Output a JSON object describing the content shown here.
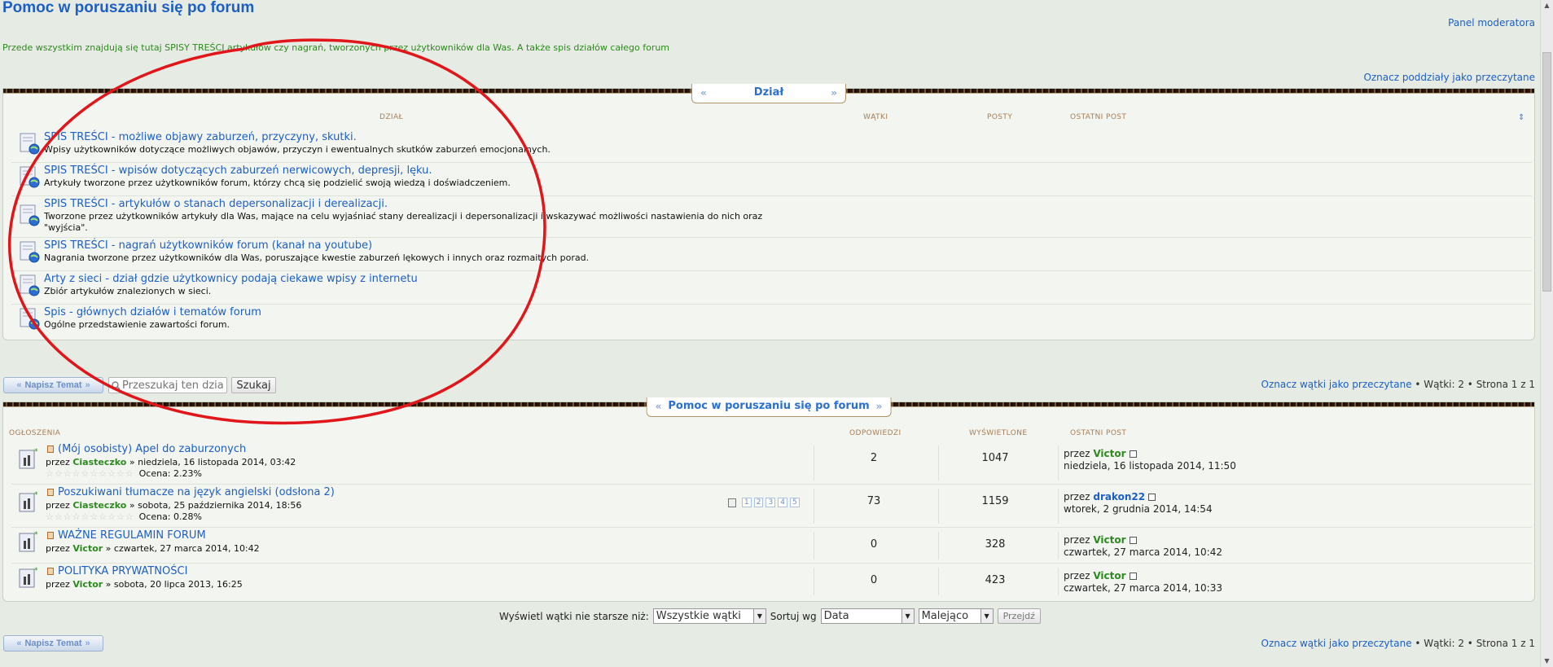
{
  "header": {
    "title": "Pomoc w poruszaniu się po forum",
    "moderator_panel": "Panel moderatora",
    "intro": "Przede wszystkim znajdują się tutaj SPISY TREŚCI artykułów czy nagrań, tworzonych przez użytkowników dla Was. A także spis działów całego forum",
    "mark_subforums_read": "Oznacz poddziały jako przeczytane"
  },
  "subforums": {
    "tab_label": "Dział",
    "columns": {
      "forum": "DZIAŁ",
      "threads": "WĄTKI",
      "posts": "POSTY",
      "last_post": "OSTATNI POST"
    },
    "rows": [
      {
        "title": "SPIS TREŚCI - możliwe objawy zaburzeń, przyczyny, skutki.",
        "desc": "Wpisy użytkowników dotyczące możliwych objawów, przyczyn i ewentualnych skutków zaburzeń emocjonalnych."
      },
      {
        "title": "SPIS TREŚCI - wpisów dotyczących zaburzeń nerwicowych, depresji, lęku.",
        "desc": "Artykuły tworzone przez użytkowników forum, którzy chcą się podzielić swoją wiedzą i doświadczeniem."
      },
      {
        "title": "SPIS TREŚCI - artykułów o stanach depersonalizacji i derealizacji.",
        "desc": "Tworzone przez użytkowników artykuły dla Was, mające na celu wyjaśniać stany derealizacji i depersonalizacji i wskazywać możliwości nastawienia do nich oraz \"wyjścia\"."
      },
      {
        "title": "SPIS TREŚCI - nagrań użytkowników forum (kanał na youtube)",
        "desc": "Nagrania tworzone przez użytkowników dla Was, poruszające kwestie zaburzeń lękowych i innych oraz rozmaitych porad."
      },
      {
        "title": "Arty z sieci - dział gdzie użytkownicy podają ciekawe wpisy z internetu",
        "desc": "Zbiór artykułów znalezionych w sieci."
      },
      {
        "title": "Spis - głównych działów i tematów forum",
        "desc": "Ogólne przedstawienie zawartości forum."
      }
    ]
  },
  "toolbar": {
    "new_topic": "Napisz Temat",
    "search_placeholder": "Przeszukaj ten dział",
    "search_button": "Szukaj",
    "mark_topics_read": "Oznacz wątki jako przeczytane",
    "stats": " • Wątki: 2 • Strona 1 z 1"
  },
  "topics": {
    "tab_label": "Pomoc w poruszaniu się po forum",
    "columns": {
      "announcements": "OGŁOSZENIA",
      "replies": "ODPOWIEDZI",
      "views": "WYŚWIETLONE",
      "last_post": "OSTATNI POST"
    },
    "rows": [
      {
        "title": "(Mój osobisty) Apel do zaburzonych",
        "by": "przez",
        "author": "Ciasteczko",
        "date": " » niedziela, 16 listopada 2014, 03:42",
        "rating": "Ocena: 2.23%",
        "replies": "2",
        "views": "1047",
        "lp_by": "przez",
        "lp_author": "Victor",
        "lp_date": "niedziela, 16 listopada 2014, 11:50"
      },
      {
        "title": "Poszukiwani tłumacze na język angielski (odsłona 2)",
        "by": "przez",
        "author": "Ciasteczko",
        "date": " » sobota, 25 października 2014, 18:56",
        "rating": "Ocena: 0.28%",
        "replies": "73",
        "views": "1159",
        "lp_by": "przez",
        "lp_author": "drakon22",
        "lp_date": "wtorek, 2 grudnia 2014, 14:54",
        "pages": [
          "1",
          "2",
          "3",
          "4",
          "5"
        ]
      },
      {
        "title": "WAŻNE REGULAMIN FORUM",
        "by": "przez",
        "author": "Victor",
        "date": " » czwartek, 27 marca 2014, 10:42",
        "replies": "0",
        "views": "328",
        "lp_by": "przez",
        "lp_author": "Victor",
        "lp_date": "czwartek, 27 marca 2014, 10:42"
      },
      {
        "title": "POLITYKA PRYWATNOŚCI",
        "by": "przez",
        "author": "Victor",
        "date": " » sobota, 20 lipca 2013, 16:25",
        "replies": "0",
        "views": "423",
        "lp_by": "przez",
        "lp_author": "Victor",
        "lp_date": "czwartek, 27 marca 2014, 10:33"
      }
    ]
  },
  "filter": {
    "show_label": "Wyświetl wątki nie starsze niż:",
    "show_value": "Wszystkie wątki",
    "sort_label": "Sortuj wg",
    "sort_value": "Data",
    "order_value": "Malejąco",
    "go_button": "Przejdź"
  },
  "colors": {
    "link": "#1d5fc5",
    "username": "#2d8a1f",
    "annotation": "#e0161b"
  }
}
